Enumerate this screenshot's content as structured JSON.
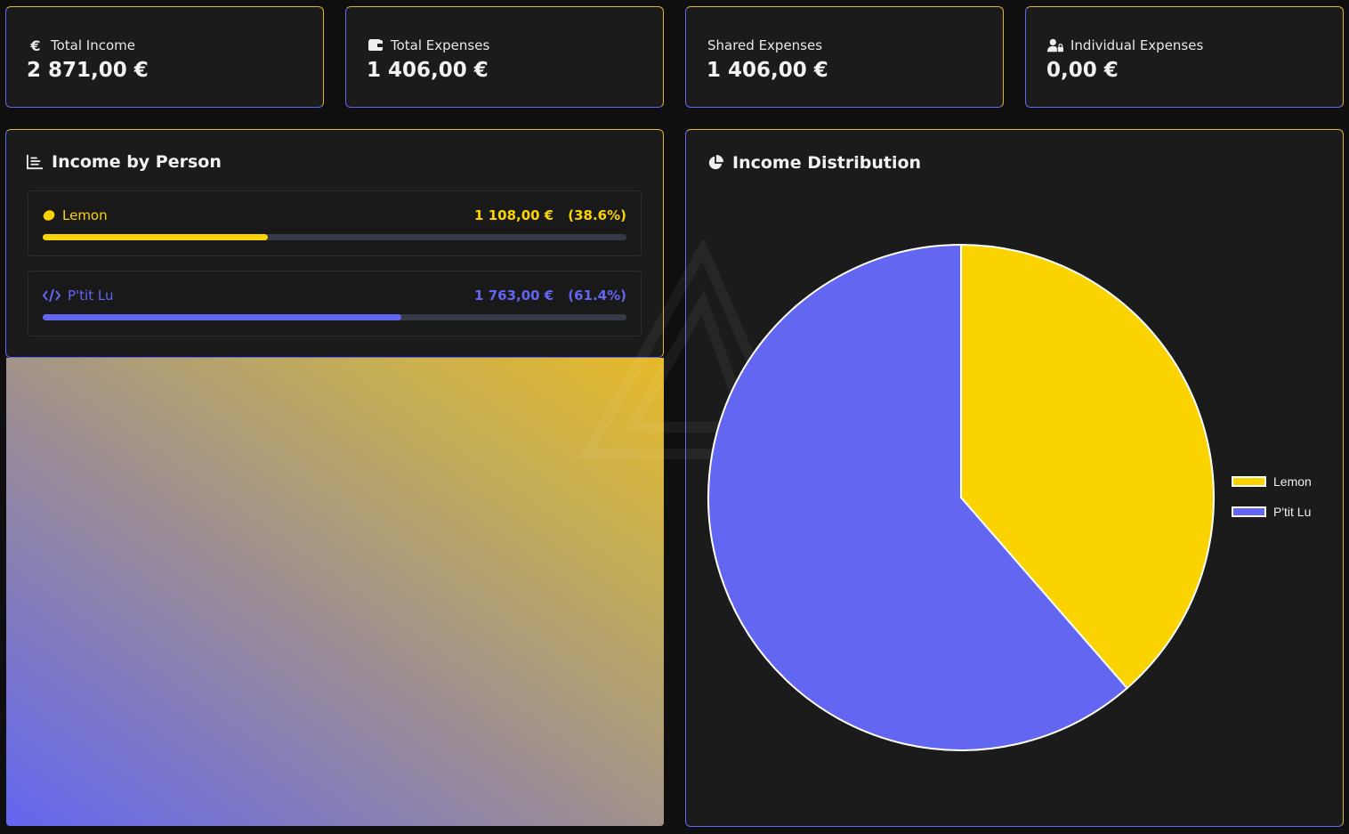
{
  "stats": [
    {
      "label": "Total Income",
      "value": "2 871,00 €",
      "icon": "euro-icon"
    },
    {
      "label": "Total Expenses",
      "value": "1 406,00 €",
      "icon": "wallet-icon"
    },
    {
      "label": "Shared Expenses",
      "value": "1 406,00 €",
      "icon": "users-icon"
    },
    {
      "label": "Individual Expenses",
      "value": "0,00 €",
      "icon": "user-lock-icon"
    }
  ],
  "income_by_person": {
    "title": "Income by Person",
    "people": [
      {
        "name": "Lemon",
        "amount": "1 108,00 €",
        "percent_label": "(38.6%)",
        "share": 0.386,
        "color": "#fad300",
        "icon": "lemon-icon"
      },
      {
        "name": "P'tit Lu",
        "amount": "1 763,00 €",
        "percent_label": "(61.4%)",
        "share": 0.614,
        "color": "#6366f1",
        "icon": "code-icon"
      }
    ]
  },
  "income_distribution": {
    "title": "Income Distribution"
  },
  "chart_data": {
    "type": "pie",
    "categories": [
      "Lemon",
      "P'tit Lu"
    ],
    "values": [
      1108,
      1763
    ],
    "colors": [
      "#fad300",
      "#6366f1"
    ],
    "legend_position": "right"
  }
}
